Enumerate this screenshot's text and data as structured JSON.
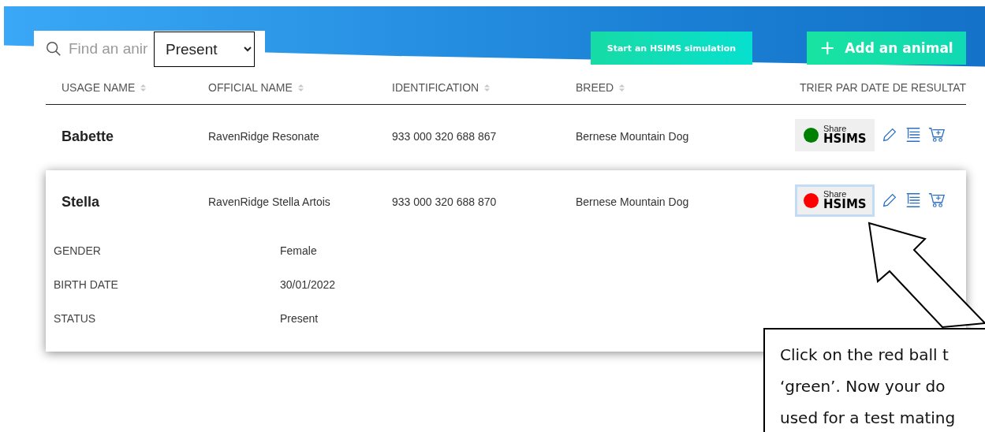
{
  "toolbar": {
    "search": {
      "placeholder": "Find an anir"
    },
    "status_filter": {
      "value": "Present"
    },
    "buttons": [
      {
        "kind": "simulation",
        "label": "Start an HSIMS simulation"
      },
      {
        "kind": "add",
        "icon": "+",
        "label": "Add an animal"
      }
    ]
  },
  "table": {
    "columns": [
      {
        "label": "USAGE NAME",
        "sortable": true
      },
      {
        "label": "OFFICIAL NAME",
        "sortable": true
      },
      {
        "label": "IDENTIFICATION",
        "sortable": true
      },
      {
        "label": "BREED",
        "sortable": true
      },
      {
        "label": "TRIER PAR DATE DE RESULTAT",
        "sortable": false
      }
    ],
    "rows": [
      {
        "usage_name": "Babette",
        "official_name": "RavenRidge Resonate",
        "identification": "933 000 320 688 867",
        "breed": "Bernese Mountain Dog",
        "share": {
          "small": "Share",
          "big": "HSIMS",
          "color": "#008000",
          "selected": false
        },
        "expanded": false,
        "details": []
      },
      {
        "usage_name": "Stella",
        "official_name": "RavenRidge Stella Artois",
        "identification": "933 000 320 688 870",
        "breed": "Bernese Mountain Dog",
        "share": {
          "small": "Share",
          "big": "HSIMS",
          "color": "#ff0000",
          "selected": true
        },
        "expanded": true,
        "details": [
          {
            "label": "GENDER",
            "value": "Female"
          },
          {
            "label": "BIRTH DATE",
            "value": "30/01/2022"
          },
          {
            "label": "STATUS",
            "value": "Present"
          }
        ]
      }
    ]
  },
  "callout": {
    "lines": [
      "Click on the red ball t",
      "‘green’.  Now your do",
      "used for a test mating"
    ]
  }
}
